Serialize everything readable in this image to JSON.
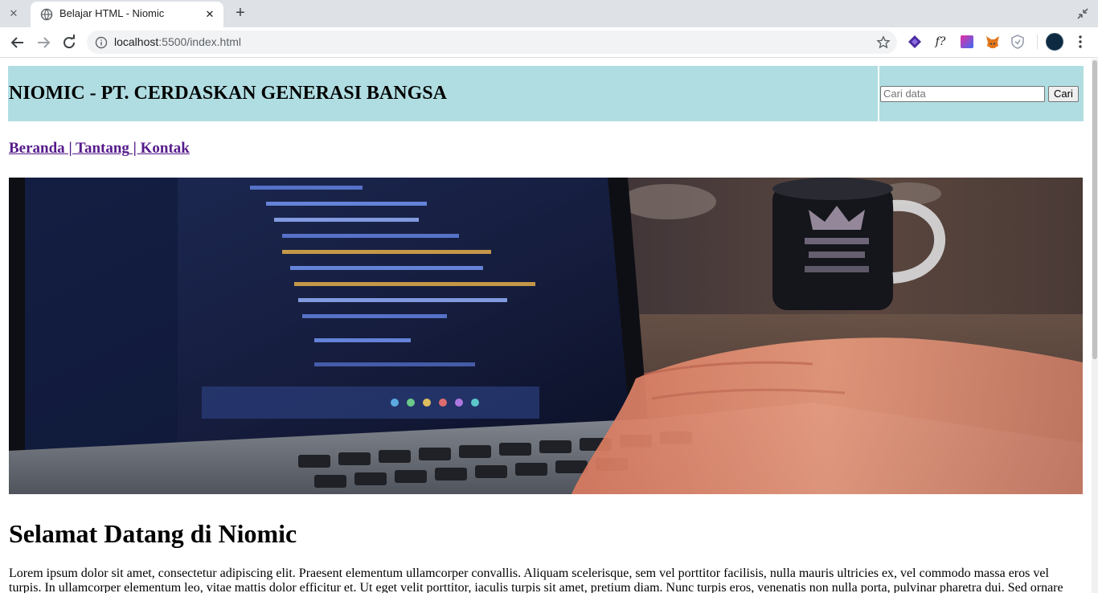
{
  "browser": {
    "tab_title": "Belajar HTML - Niomic",
    "url_host": "localhost",
    "url_path": ":5500/index.html",
    "new_tab": "+",
    "close_glyph": "✕",
    "extensions": [
      "stack-icon",
      "function-icon",
      "gradient-square-icon",
      "fox-icon",
      "shield-icon"
    ],
    "extension_function_label": "f?"
  },
  "header": {
    "title": "NIOMIC - PT. CERDASKAN GENERASI BANGSA",
    "background": "#b0dde2",
    "search_placeholder": "Cari data",
    "search_value": "",
    "search_button": "Cari"
  },
  "nav": {
    "items": [
      "Beranda",
      "Tantang",
      "Kontak"
    ],
    "separator": " | ",
    "link_color": "#551a8b"
  },
  "hero": {
    "subject": "laptop-with-code-and-mug"
  },
  "main": {
    "heading": "Selamat Datang di Niomic",
    "paragraph": "Lorem ipsum dolor sit amet, consectetur adipiscing elit. Praesent elementum ullamcorper convallis. Aliquam scelerisque, sem vel porttitor facilisis, nulla mauris ultricies ex, vel commodo massa eros vel turpis. In ullamcorper elementum leo, vitae mattis dolor efficitur et. Ut eget velit porttitor, iaculis turpis sit amet, pretium diam. Nunc turpis eros, venenatis non nulla porta, pulvinar pharetra dui. Sed ornare"
  }
}
